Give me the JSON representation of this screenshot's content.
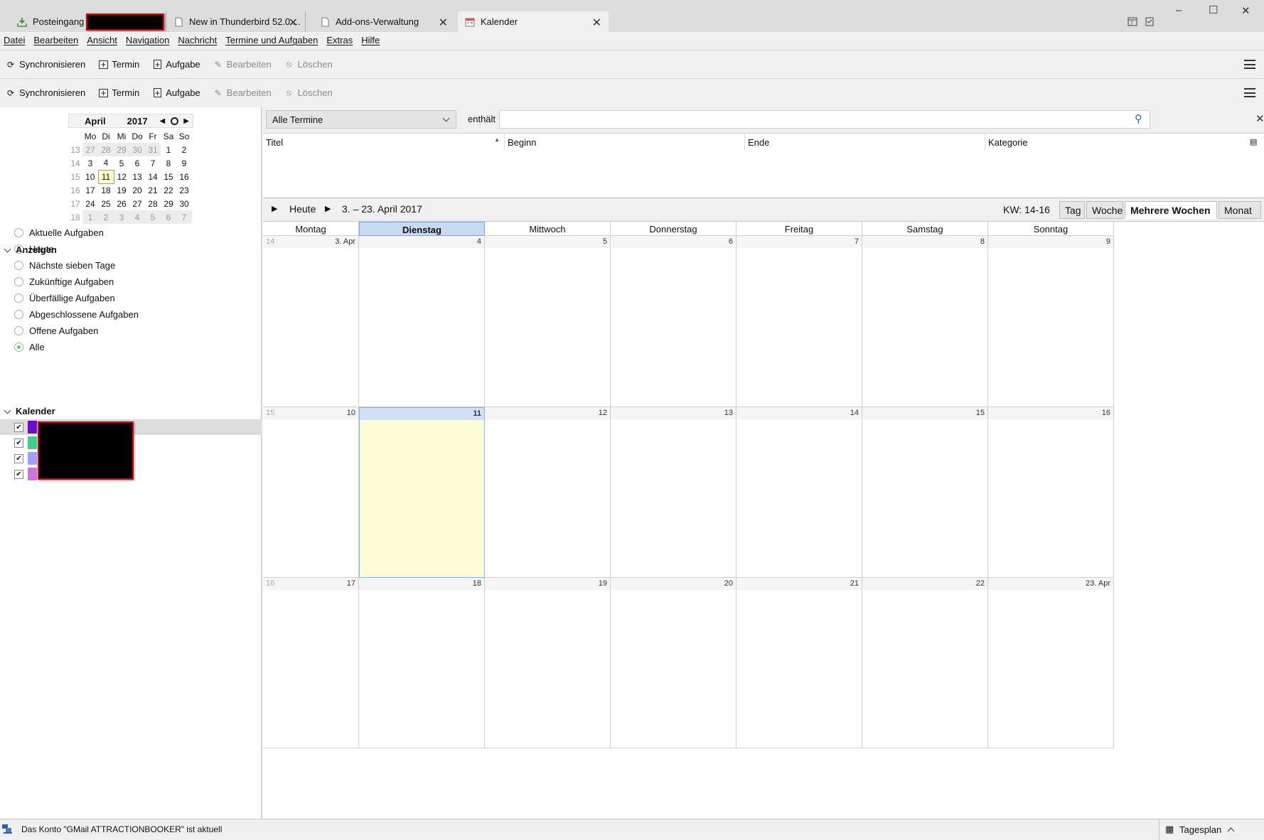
{
  "tabs": [
    {
      "label": "Posteingang -",
      "icon": "inbox-download-icon"
    },
    {
      "label": "New in Thunderbird 52.0 ...",
      "icon": "page-icon"
    },
    {
      "label": "Add-ons-Verwaltung",
      "icon": "page-icon"
    },
    {
      "label": "Kalender",
      "icon": "calendar-icon"
    }
  ],
  "window_controls": {
    "minimize": "–",
    "maximize": "☐",
    "close": "✕"
  },
  "menu": [
    "Datei",
    "Bearbeiten",
    "Ansicht",
    "Navigation",
    "Nachricht",
    "Termine und Aufgaben",
    "Extras",
    "Hilfe"
  ],
  "toolbar": {
    "sync": "Synchronisieren",
    "event": "Termin",
    "task": "Aufgabe",
    "edit": "Bearbeiten",
    "delete": "Löschen"
  },
  "minicalendar": {
    "month": "April",
    "year": "2017",
    "weekdays": [
      "Mo",
      "Di",
      "Mi",
      "Do",
      "Fr",
      "Sa",
      "So"
    ],
    "weeks": [
      {
        "wk": "13",
        "days": [
          "27",
          "28",
          "29",
          "30",
          "31",
          "1",
          "2"
        ]
      },
      {
        "wk": "14",
        "days": [
          "3",
          "4",
          "5",
          "6",
          "7",
          "8",
          "9"
        ]
      },
      {
        "wk": "15",
        "days": [
          "10",
          "11",
          "12",
          "13",
          "14",
          "15",
          "16"
        ]
      },
      {
        "wk": "16",
        "days": [
          "17",
          "18",
          "19",
          "20",
          "21",
          "22",
          "23"
        ]
      },
      {
        "wk": "17",
        "days": [
          "24",
          "25",
          "26",
          "27",
          "28",
          "29",
          "30"
        ]
      },
      {
        "wk": "18",
        "days": [
          "1",
          "2",
          "3",
          "4",
          "5",
          "6",
          "7"
        ]
      }
    ],
    "today": "11"
  },
  "show_section": {
    "title": "Anzeigen",
    "options": [
      "Aktuelle Aufgaben",
      "Heute",
      "Nächste sieben Tage",
      "Zukünftige Aufgaben",
      "Überfällige Aufgaben",
      "Abgeschlossene Aufgaben",
      "Offene Aufgaben",
      "Alle"
    ],
    "selected": "Alle"
  },
  "calendars_section": {
    "title": "Kalender",
    "colors": [
      "#6a0dd1",
      "#3fcf8e",
      "#9fa0ff",
      "#cf73e0"
    ]
  },
  "filter": {
    "select_value": "Alle Termine",
    "contains_label": "enthält",
    "search_value": ""
  },
  "task_columns": [
    "Titel",
    "Beginn",
    "Ende",
    "Kategorie"
  ],
  "viewbar": {
    "today": "Heute",
    "range": "3. – 23. April 2017",
    "week_info": "KW: 14-16",
    "views": [
      "Tag",
      "Woche",
      "Mehrere Wochen",
      "Monat"
    ],
    "active_view": "Mehrere Wochen"
  },
  "grid": {
    "weekdays": [
      "Montag",
      "Dienstag",
      "Mittwoch",
      "Donnerstag",
      "Freitag",
      "Samstag",
      "Sonntag"
    ],
    "selected_weekday": "Dienstag",
    "weeks": [
      {
        "wk": "14",
        "days": [
          "3. Apr",
          "4",
          "5",
          "6",
          "7",
          "8",
          "9"
        ]
      },
      {
        "wk": "15",
        "days": [
          "10",
          "11",
          "12",
          "13",
          "14",
          "15",
          "16"
        ]
      },
      {
        "wk": "16",
        "days": [
          "17",
          "18",
          "19",
          "20",
          "21",
          "22",
          "23. Apr"
        ]
      }
    ],
    "today": "11"
  },
  "statusbar": {
    "message": "Das Konto \"GMail ATTRACTIONBOOKER\" ist aktuell",
    "agenda": "Tagesplan"
  }
}
